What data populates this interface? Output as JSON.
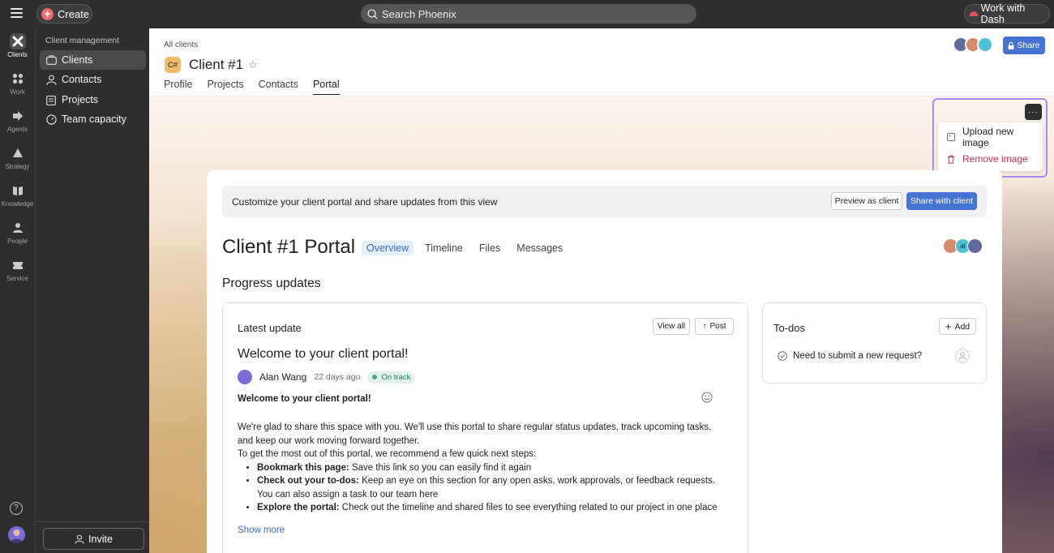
{
  "topbar": {
    "create_label": "Create",
    "search_placeholder": "Search Phoenix",
    "dash_label": "Work with Dash"
  },
  "rail": {
    "items": [
      {
        "label": "Clients",
        "icon": "clients-icon"
      },
      {
        "label": "Work",
        "icon": "work-icon"
      },
      {
        "label": "Agents",
        "icon": "agents-icon"
      },
      {
        "label": "Strategy",
        "icon": "strategy-icon"
      },
      {
        "label": "Knowledge",
        "icon": "knowledge-icon"
      },
      {
        "label": "People",
        "icon": "people-icon"
      },
      {
        "label": "Service",
        "icon": "service-icon"
      }
    ],
    "help_label": "?"
  },
  "sidebar": {
    "heading": "Client management",
    "items": [
      {
        "label": "Clients",
        "icon": "clients-icon"
      },
      {
        "label": "Contacts",
        "icon": "contacts-icon"
      },
      {
        "label": "Projects",
        "icon": "projects-icon"
      },
      {
        "label": "Team capacity",
        "icon": "team-capacity-icon"
      }
    ],
    "invite_label": "Invite"
  },
  "header": {
    "breadcrumb": "All clients",
    "badge": "C#",
    "title": "Client #1",
    "tabs": [
      "Profile",
      "Projects",
      "Contacts",
      "Portal"
    ],
    "share_label": "Share"
  },
  "cover_menu": {
    "more_label": "···",
    "upload_label": "Upload new image",
    "remove_label": "Remove image"
  },
  "portal": {
    "banner_text": "Customize your client portal and share updates from this view",
    "preview_label": "Preview as client",
    "share_client_label": "Share with client",
    "title": "Client #1 Portal",
    "tabs": [
      "Overview",
      "Timeline",
      "Files",
      "Messages"
    ],
    "avatar_initials": "al",
    "section_title": "Progress updates"
  },
  "update": {
    "heading": "Latest update",
    "view_all_label": "View all",
    "post_label": "Post",
    "title": "Welcome to your client portal!",
    "author": "Alan Wang",
    "time": "22 days ago",
    "status": "On track",
    "body_heading": "Welcome to your client portal!",
    "para1": "We're glad to share this space with you. We'll use this portal to share regular status updates, track upcoming tasks, and keep our work moving forward together.",
    "para2": "To get the most out of this portal, we recommend a few quick next steps:",
    "bullets": [
      {
        "bold": "Bookmark this page:",
        "text": " Save this link so you can easily find it again"
      },
      {
        "bold": "Check out your to-dos:",
        "text": " Keep an eye on this section for any open asks, work approvals, or feedback requests. You can also assign a task to our team here"
      },
      {
        "bold": "Explore the portal:",
        "text": " Check out the timeline and shared files to see everything related to our project in one place"
      }
    ],
    "show_more": "Show more"
  },
  "todos": {
    "heading": "To-dos",
    "add_label": "Add",
    "items": [
      {
        "label": "Need to submit a new request?"
      }
    ]
  },
  "colors": {
    "accent": "#4573d2",
    "danger": "#c92f54",
    "on_track": "#43a97c",
    "client_badge": "#f1bd6c",
    "topbar": "#2e2e30"
  }
}
